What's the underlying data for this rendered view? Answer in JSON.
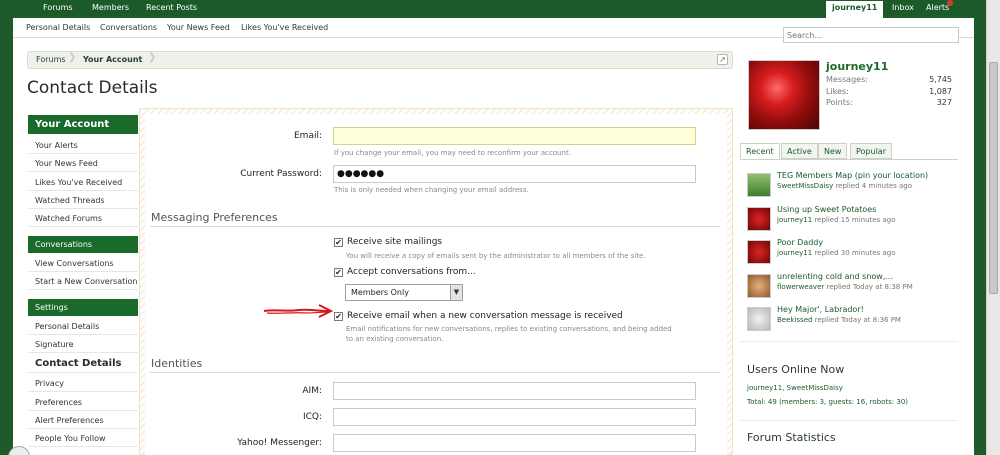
{
  "topnav": {
    "items": [
      "Forums",
      "Members",
      "Recent Posts"
    ],
    "user": "journey11",
    "inbox": "Inbox",
    "alerts": "Alerts"
  },
  "subnav": {
    "items": [
      "Personal Details",
      "Conversations",
      "Your News Feed",
      "Likes You've Received"
    ],
    "search_placeholder": "Search..."
  },
  "breadcrumb": [
    "Forums",
    "Your Account"
  ],
  "page_title": "Contact Details",
  "sidebar": {
    "account_head": "Your Account",
    "account_items": [
      "Your Alerts",
      "Your News Feed",
      "Likes You've Received",
      "Watched Threads",
      "Watched Forums"
    ],
    "conversations_head": "Conversations",
    "conversations_items": [
      "View Conversations",
      "Start a New Conversation"
    ],
    "settings_head": "Settings",
    "settings_items": [
      "Personal Details",
      "Signature",
      "Contact Details",
      "Privacy",
      "Preferences",
      "Alert Preferences",
      "People You Follow"
    ]
  },
  "form": {
    "email_label": "Email:",
    "email_value": "",
    "email_hint": "If you change your email, you may need to reconfirm your account.",
    "password_label": "Current Password:",
    "password_value": "●●●●●●",
    "password_hint": "This is only needed when changing your email address.",
    "messaging_head": "Messaging Preferences",
    "site_mailings_label": "Receive site mailings",
    "site_mailings_hint": "You will receive a copy of emails sent by the administrator to all members of the site.",
    "accept_conv_label": "Accept conversations from...",
    "accept_conv_value": "Members Only",
    "receive_email_label": "Receive email when a new conversation message is received",
    "receive_email_hint_1": "Email notifications for new conversations, replies to existing conversations, and being added",
    "receive_email_hint_2": "to an existing conversation.",
    "identities_head": "Identities",
    "aim_label": "AIM:",
    "icq_label": "ICQ:",
    "yahoo_label": "Yahoo! Messenger:",
    "checked_mark": "✔"
  },
  "profile": {
    "username": "journey11",
    "messages_label": "Messages:",
    "messages_value": "5,745",
    "likes_label": "Likes:",
    "likes_value": "1,087",
    "points_label": "Points:",
    "points_value": "327"
  },
  "tabs": [
    "Recent",
    "Active",
    "New",
    "Popular"
  ],
  "threads": [
    {
      "title": "TEG Members Map (pin your location)",
      "user": "SweetMissDaisy",
      "meta": " replied 4 minutes ago"
    },
    {
      "title": "Using up Sweet Potatoes",
      "user": "journey11",
      "meta": " replied 15 minutes ago"
    },
    {
      "title": "Poor Daddy",
      "user": "journey11",
      "meta": " replied 30 minutes ago"
    },
    {
      "title": "unrelenting cold and snow,...",
      "user": "flowerweaver",
      "meta": " replied Today at 8:38 PM"
    },
    {
      "title": "Hey Major', Labrador!",
      "user": "Beekissed",
      "meta": " replied Today at 8:36 PM"
    }
  ],
  "online": {
    "head": "Users Online Now",
    "users": "journey11, SweetMissDaisy",
    "total": "Total: 49 (members: 3, guests: 16, robots: 30)"
  },
  "forum_stats_head": "Forum Statistics",
  "colors": {
    "brand_green": "#1c5a2a",
    "annotation_red": "#d81818"
  }
}
